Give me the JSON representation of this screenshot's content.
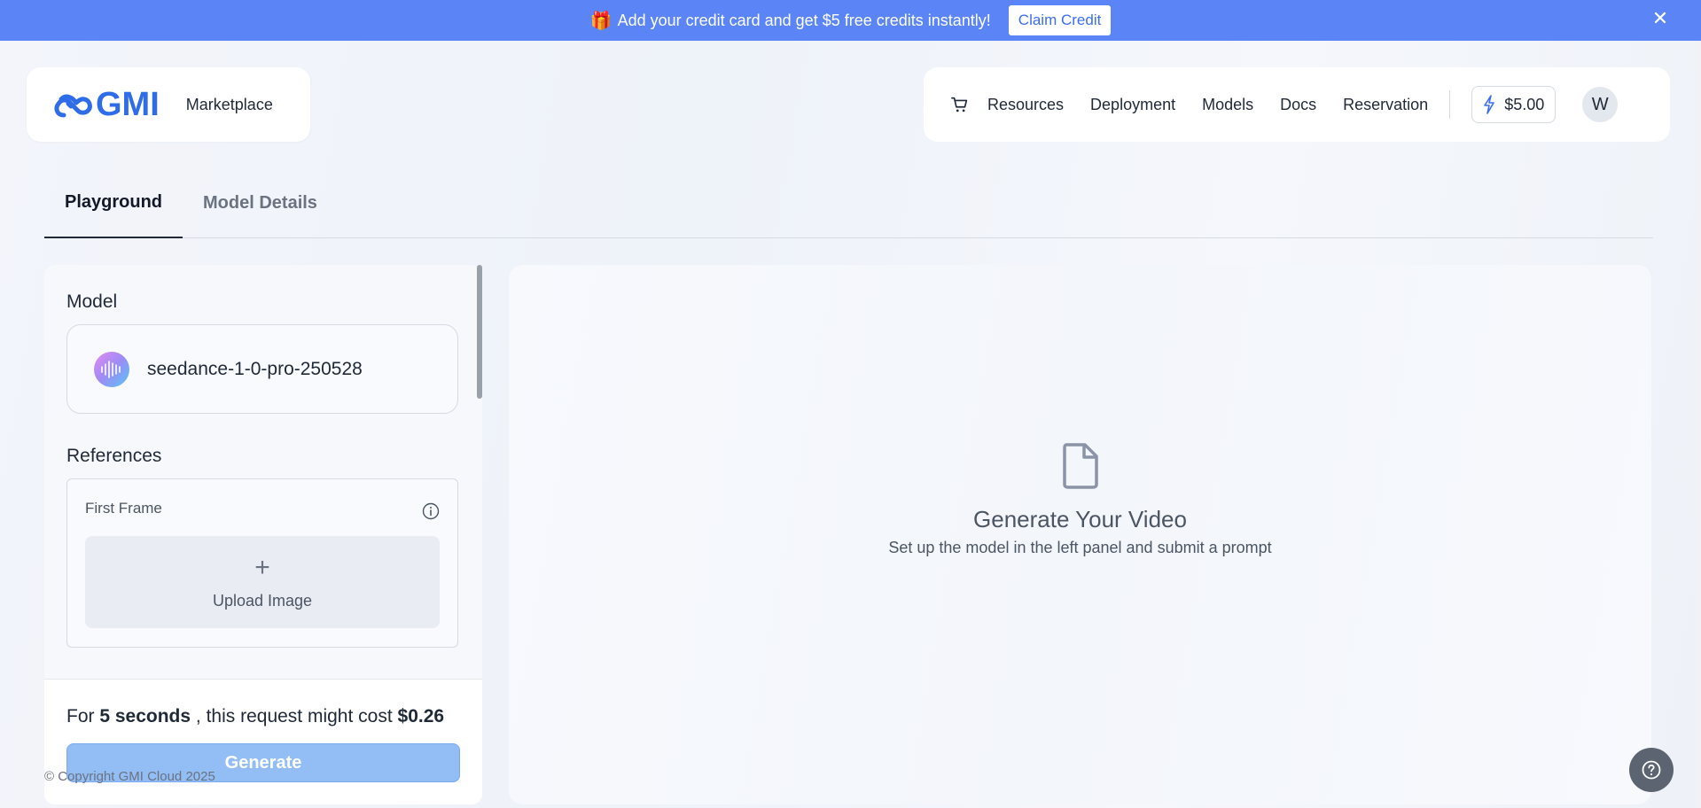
{
  "banner": {
    "gift": "🎁",
    "text": "Add your credit card and get $5 free credits instantly!",
    "claim_label": "Claim Credit",
    "close_icon": "close-icon"
  },
  "header": {
    "logo_text": "GMI",
    "marketplace": "Marketplace",
    "nav": [
      "Resources",
      "Deployment",
      "Models",
      "Docs",
      "Reservation"
    ],
    "balance": "$5.00",
    "avatar": "W"
  },
  "tabs": [
    {
      "label": "Playground",
      "active": true
    },
    {
      "label": "Model Details",
      "active": false
    }
  ],
  "left_panel": {
    "model_label": "Model",
    "model_name": "seedance-1-0-pro-250528",
    "references_label": "References",
    "first_frame_label": "First Frame",
    "upload_label": "Upload Image",
    "cost": {
      "prefix": "For",
      "duration": "5 seconds",
      "middle": ", this request might cost",
      "price": "$0.26"
    },
    "generate_label": "Generate"
  },
  "right_panel": {
    "title": "Generate Your Video",
    "subtitle": "Set up the model in the left panel and submit a prompt"
  },
  "footer": {
    "copyright": "© Copyright GMI Cloud 2025"
  },
  "colors": {
    "banner": "#5b85f7",
    "brand": "#2f6de8",
    "generate_disabled": "#92bdf5"
  }
}
